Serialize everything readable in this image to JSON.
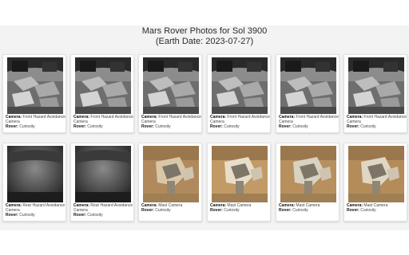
{
  "page": {
    "title_line1": "Mars Rover Photos for Sol 3900",
    "title_line2": "(Earth Date: 2023-07-27)"
  },
  "labels": {
    "camera": "Camera:",
    "rover": "Rover:"
  },
  "photos": [
    {
      "camera": "Front Hazard Avoidance Camera",
      "rover": "Curiosity",
      "kind": "front-hazcam"
    },
    {
      "camera": "Front Hazard Avoidance Camera",
      "rover": "Curiosity",
      "kind": "front-hazcam"
    },
    {
      "camera": "Front Hazard Avoidance Camera",
      "rover": "Curiosity",
      "kind": "front-hazcam"
    },
    {
      "camera": "Front Hazard Avoidance Camera",
      "rover": "Curiosity",
      "kind": "front-hazcam"
    },
    {
      "camera": "Front Hazard Avoidance Camera",
      "rover": "Curiosity",
      "kind": "front-hazcam"
    },
    {
      "camera": "Front Hazard Avoidance Camera",
      "rover": "Curiosity",
      "kind": "front-hazcam"
    },
    {
      "camera": "Rear Hazard Avoidance Camera",
      "rover": "Curiosity",
      "kind": "rear-hazcam"
    },
    {
      "camera": "Rear Hazard Avoidance Camera",
      "rover": "Curiosity",
      "kind": "rear-hazcam"
    },
    {
      "camera": "Mast Camera",
      "rover": "Curiosity",
      "kind": "mastcam-a"
    },
    {
      "camera": "Mast Camera",
      "rover": "Curiosity",
      "kind": "mastcam-b"
    },
    {
      "camera": "Mast Camera",
      "rover": "Curiosity",
      "kind": "mastcam-c"
    },
    {
      "camera": "Mast Camera",
      "rover": "Curiosity",
      "kind": "mastcam-d"
    }
  ]
}
